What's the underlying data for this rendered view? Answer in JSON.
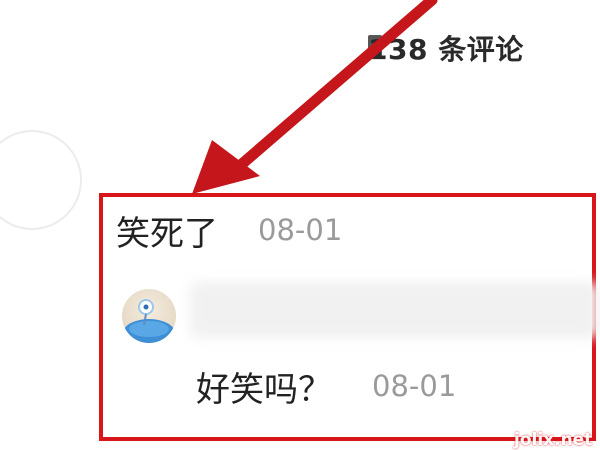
{
  "header": {
    "comment_count_label": "138 条评论"
  },
  "comment": {
    "text": "笑死了",
    "time": "08-01",
    "reply": {
      "text": "好笑吗？",
      "time": "08-01"
    }
  },
  "annotation": {
    "box_color": "#d8151b",
    "arrow_color": "#c5161b"
  },
  "watermark": {
    "text": "jolix.net"
  }
}
